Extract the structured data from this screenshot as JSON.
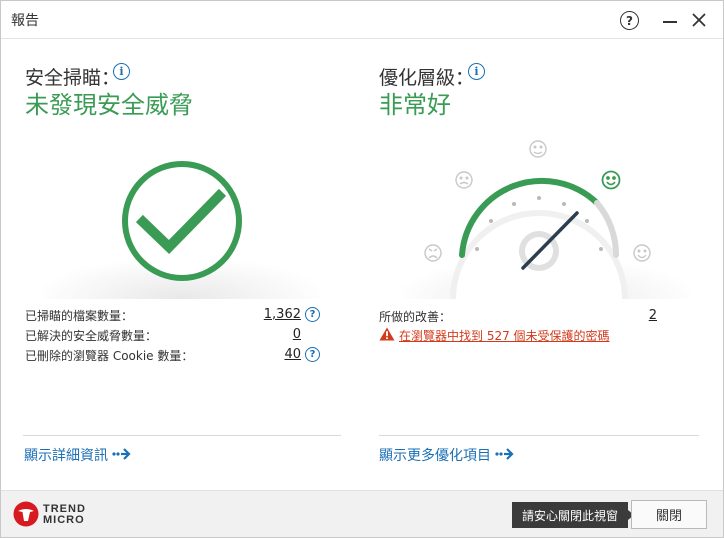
{
  "window": {
    "title": "報告"
  },
  "security": {
    "title": "安全掃瞄：",
    "status": "未發現安全威脅",
    "stats": [
      {
        "label": "已掃瞄的檔案數量：",
        "value": "1,362"
      },
      {
        "label": "已解決的安全威脅數量：",
        "value": "0"
      },
      {
        "label": "已刪除的瀏覽器 Cookie 數量：",
        "value": "40"
      }
    ],
    "details_link": "顯示詳細資訊"
  },
  "optimization": {
    "title": "優化層級：",
    "status": "非常好",
    "improvements_label": "所做的改善：",
    "improvements_value": "2",
    "warning": "在瀏覽器中找到 527 個未受保護的密碼",
    "more_link": "顯示更多優化項目",
    "gauge_level": "very-good"
  },
  "footer": {
    "brand_line1": "TREND",
    "brand_line2": "MICRO",
    "tooltip": "請安心關閉此視窗",
    "close_label": "關閉"
  },
  "colors": {
    "accent_green": "#3a9b55",
    "link_blue": "#1a6fb5",
    "warning_red": "#d23a1c",
    "brand_red": "#d71920"
  }
}
